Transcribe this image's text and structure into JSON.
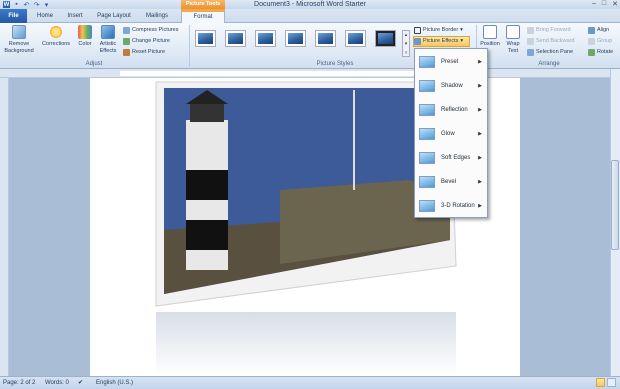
{
  "window": {
    "title": "Document3 - Microsoft Word Starter",
    "context_tab_label": "Picture Tools",
    "minimize": "–",
    "maximize": "□",
    "close": "✕"
  },
  "tabs": [
    "File",
    "Home",
    "Insert",
    "Page Layout",
    "Mailings",
    "Format"
  ],
  "ribbon": {
    "adjust": {
      "label": "Adjust",
      "remove_background": "Remove Background",
      "corrections": "Corrections",
      "color": "Color",
      "artistic_effects": "Artistic Effects",
      "compress_pictures": "Compress Pictures",
      "change_picture": "Change Picture",
      "reset_picture": "Reset Picture"
    },
    "picture_styles": {
      "label": "Picture Styles",
      "picture_border": "Picture Border",
      "picture_effects": "Picture Effects"
    },
    "arrange": {
      "label": "Arrange",
      "position": "Position",
      "wrap_text": "Wrap Text",
      "bring_forward": "Bring Forward",
      "send_backward": "Send Backward",
      "selection_pane": "Selection Pane",
      "align": "Align",
      "group": "Group",
      "rotate": "Rotate"
    }
  },
  "effects_menu": {
    "items": [
      {
        "label": "Preset",
        "key": "P"
      },
      {
        "label": "Shadow",
        "key": "S"
      },
      {
        "label": "Reflection",
        "key": "R"
      },
      {
        "label": "Glow",
        "key": "G"
      },
      {
        "label": "Soft Edges",
        "key": "E"
      },
      {
        "label": "Bevel",
        "key": "B"
      },
      {
        "label": "3-D Rotation",
        "key": "D"
      }
    ]
  },
  "status": {
    "page": "Page: 2 of 2",
    "words": "Words: 0",
    "language": "English (U.S.)"
  },
  "colors": {
    "accent_orange": "#f9c75a",
    "file_tab": "#2b5fac",
    "ribbon_bg": "#dde8f5"
  }
}
